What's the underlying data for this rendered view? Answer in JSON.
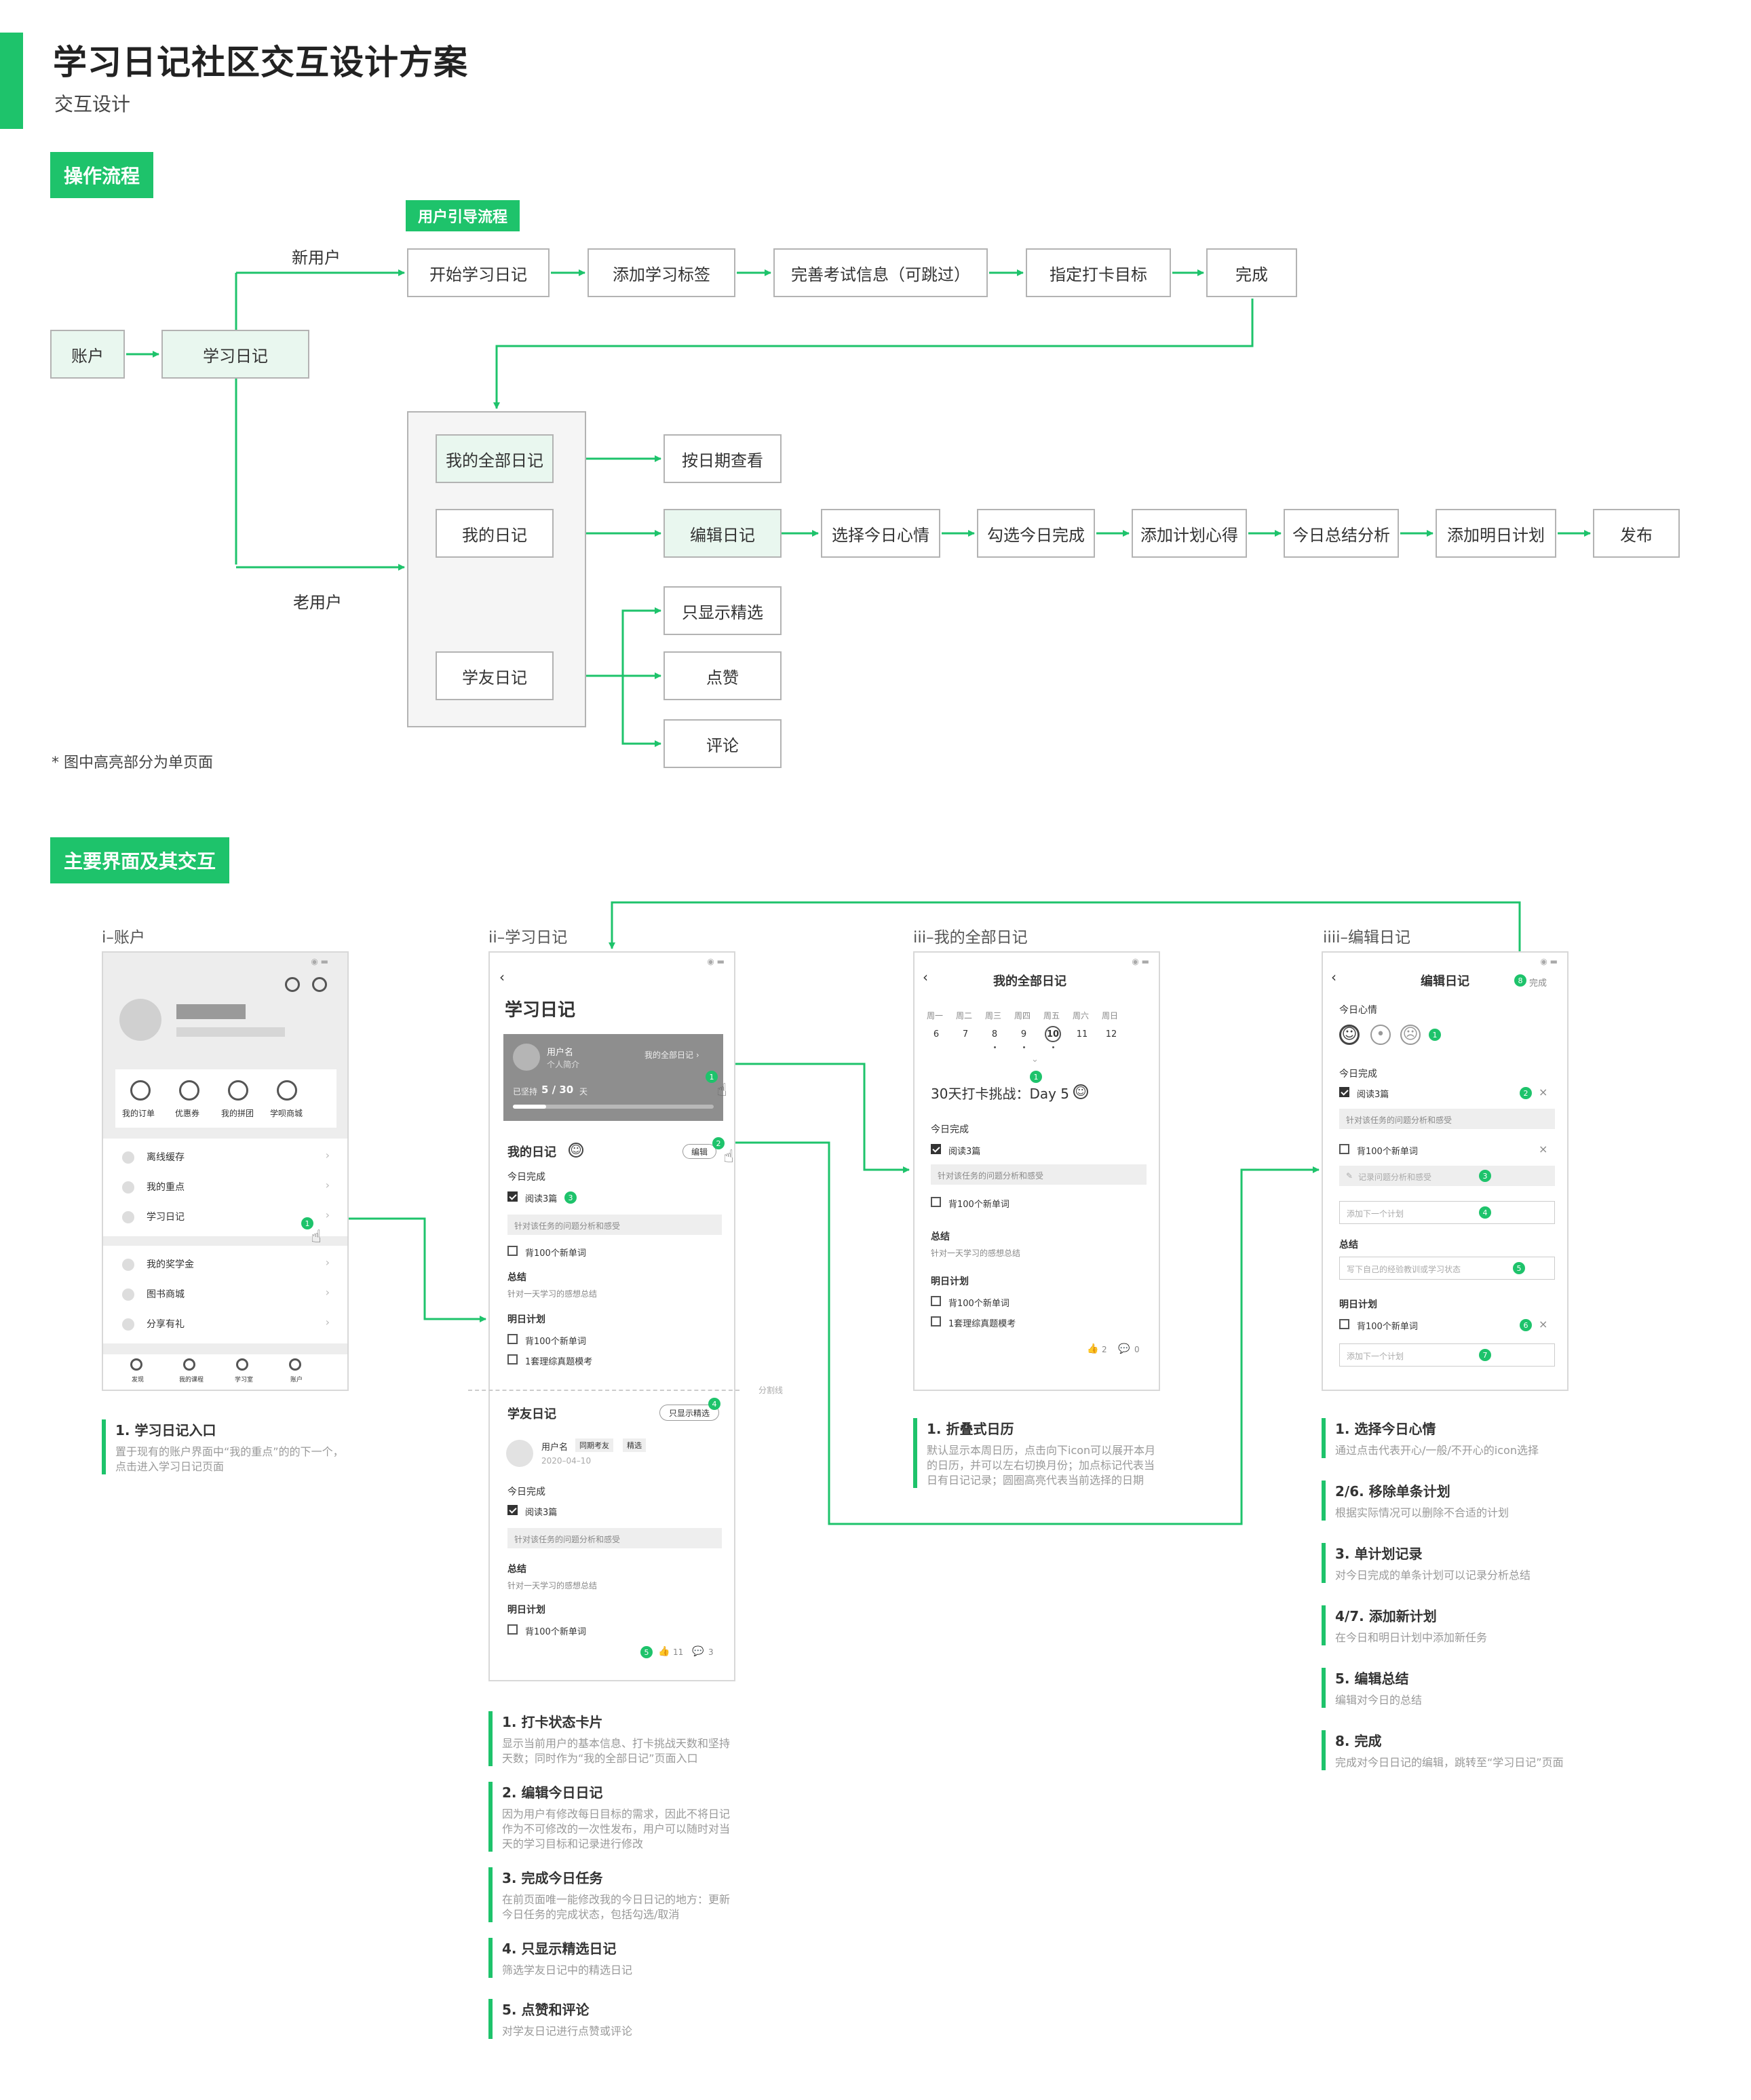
{
  "header": {
    "title": "学习日记社区交互设计方案",
    "subtitle": "交互设计"
  },
  "sections": {
    "flow": "操作流程",
    "screens": "主要界面及其交互"
  },
  "flow": {
    "guide_tag": "用户引导流程",
    "nodes": {
      "account": "账户",
      "diary": "学习日记",
      "start": "开始学习日记",
      "tags": "添加学习标签",
      "exam": "完善考试信息（可跳过）",
      "target": "指定打卡目标",
      "done": "完成",
      "all": "我的全部日记",
      "mine": "我的日记",
      "friend": "学友日记",
      "by_date": "按日期查看",
      "edit": "编辑日记",
      "mood": "选择今日心情",
      "check": "勾选今日完成",
      "plan_note": "添加计划心得",
      "summary": "今日总结分析",
      "tomorrow": "添加明日计划",
      "publish": "发布",
      "featured": "只显示精选",
      "like": "点赞",
      "comment": "评论"
    },
    "new_user": "新用户",
    "old_user": "老用户",
    "footnote": "* 图中高亮部分为单页面"
  },
  "screens": {
    "titles": [
      "i–账户",
      "ii–学习日记",
      "iii–我的全部日记",
      "iiii–编辑日记"
    ],
    "account": {
      "orders": [
        "我的订单",
        "优惠券",
        "我的拼团",
        "学呗商城"
      ],
      "menu": [
        "离线缓存",
        "我的重点",
        "学习日记",
        "我的奖学金",
        "图书商城",
        "分享有礼"
      ],
      "tabs": [
        "发现",
        "我的课程",
        "学习室",
        "账户"
      ]
    },
    "diary": {
      "title": "学习日记",
      "username": "用户名",
      "bio": "个人简介",
      "all_link": "我的全部日记 ›",
      "persist": "已坚持",
      "progress": "5 / 30",
      "days": "天",
      "my_diary": "我的日记",
      "edit": "编辑",
      "today_done": "今日完成",
      "task1": "阅读3篇",
      "task1_note": "针对该任务的问题分析和感受",
      "task2": "背100个新单词",
      "summary": "总结",
      "summary_text": "针对一天学习的感想总结",
      "tomorrow": "明日计划",
      "plan1": "背100个新单词",
      "plan2": "1套理综真题模考",
      "divider": "分割线",
      "friend_diary": "学友日记",
      "featured_btn": "只显示精选",
      "friend_user": "用户名",
      "friend_tag1": "同期考友",
      "friend_tag2": "精选",
      "friend_date": "2020–04–10",
      "f_today": "今日完成",
      "f_task": "阅读3篇",
      "f_task_note": "针对该任务的问题分析和感受",
      "f_summary": "总结",
      "f_summary_text": "针对一天学习的感想总结",
      "f_tomorrow": "明日计划",
      "f_plan": "背100个新单词",
      "likes": "11",
      "comments": "3"
    },
    "all": {
      "title": "我的全部日记",
      "weekdays": [
        "周一",
        "周二",
        "周三",
        "周四",
        "周五",
        "周六",
        "周日"
      ],
      "dates": [
        "6",
        "7",
        "8",
        "9",
        "10",
        "11",
        "12"
      ],
      "challenge": "30天打卡挑战：Day 5",
      "today_done": "今日完成",
      "task1": "阅读3篇",
      "task1_note": "针对该任务的问题分析和感受",
      "task2": "背100个新单词",
      "summary": "总结",
      "summary_text": "针对一天学习的感想总结",
      "tomorrow": "明日计划",
      "plan1": "背100个新单词",
      "plan2": "1套理综真题模考",
      "likes": "2",
      "comments": "0"
    },
    "edit": {
      "title": "编辑日记",
      "done": "完成",
      "mood": "今日心情",
      "today_done": "今日完成",
      "task1": "阅读3篇",
      "task1_note": "针对该任务的问题分析和感受",
      "task2": "背100个新单词",
      "task2_ph": "记录问题分析和感受",
      "add_plan": "添加下一个计划",
      "summary": "总结",
      "summary_ph": "写下自己的经验教训或学习状态",
      "tomorrow": "明日计划",
      "plan1": "背100个新单词",
      "add_plan2": "添加下一个计划"
    }
  },
  "descriptions": {
    "account": [
      {
        "h": "1. 学习日记入口",
        "p": "置于现有的账户界面中“我的重点”的的下一个，点击进入学习日记页面"
      }
    ],
    "diary": [
      {
        "h": "1. 打卡状态卡片",
        "p": "显示当前用户的基本信息、打卡挑战天数和坚持天数；同时作为“我的全部日记”页面入口"
      },
      {
        "h": "2. 编辑今日日记",
        "p": "因为用户有修改每日目标的需求，因此不将日记作为不可修改的一次性发布，用户可以随时对当天的学习目标和记录进行修改"
      },
      {
        "h": "3. 完成今日任务",
        "p": "在前页面唯一能修改我的今日日记的地方：更新今日任务的完成状态，包括勾选/取消"
      },
      {
        "h": "4. 只显示精选日记",
        "p": "筛选学友日记中的精选日记"
      },
      {
        "h": "5. 点赞和评论",
        "p": "对学友日记进行点赞或评论"
      }
    ],
    "all": [
      {
        "h": "1. 折叠式日历",
        "p": "默认显示本周日历，点击向下icon可以展开本月的日历，并可以左右切换月份；加点标记代表当日有日记记录；圆圈高亮代表当前选择的日期"
      }
    ],
    "edit": [
      {
        "h": "1. 选择今日心情",
        "p": "通过点击代表开心/一般/不开心的icon选择"
      },
      {
        "h": "2/6. 移除单条计划",
        "p": "根据实际情况可以删除不合适的计划"
      },
      {
        "h": "3. 单计划记录",
        "p": "对今日完成的单条计划可以记录分析总结"
      },
      {
        "h": "4/7. 添加新计划",
        "p": "在今日和明日计划中添加新任务"
      },
      {
        "h": "5. 编辑总结",
        "p": "编辑对今日的总结"
      },
      {
        "h": "8. 完成",
        "p": "完成对今日日记的编辑，跳转至“学习日记”页面"
      }
    ]
  },
  "colors": {
    "accent": "#1ec36b",
    "highlight_fill": "#e9f7ef",
    "box_border": "#b3b3b3"
  }
}
